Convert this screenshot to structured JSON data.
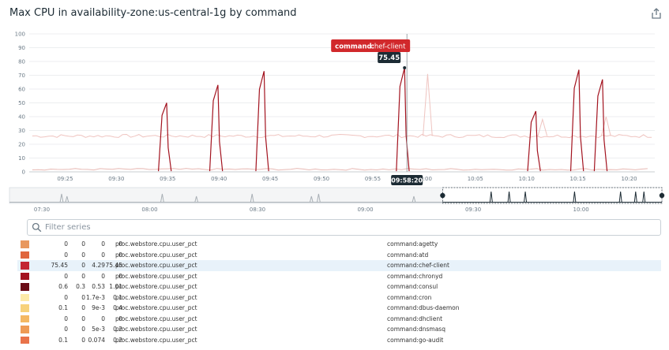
{
  "title": "Max CPU in availability-zone:us-central-1g by command",
  "icons": {
    "share": "share-export-icon",
    "search": "search-icon"
  },
  "filter": {
    "placeholder": "Filter series"
  },
  "tooltip": {
    "key": "command:",
    "value": " chef-client",
    "number": "75.45",
    "time": "09:58:20"
  },
  "chart_data": {
    "type": "line",
    "ylim": [
      0,
      100
    ],
    "yticks": [
      "0",
      "10",
      "20",
      "30",
      "40",
      "50",
      "60",
      "70",
      "80",
      "90",
      "100"
    ],
    "xlim_minutes": [
      561.5,
      622.5
    ],
    "xticks": [
      {
        "label": "09:25",
        "m": 565
      },
      {
        "label": "09:30",
        "m": 570
      },
      {
        "label": "09:35",
        "m": 575
      },
      {
        "label": "09:40",
        "m": 580
      },
      {
        "label": "09:45",
        "m": 585
      },
      {
        "label": "09:50",
        "m": 590
      },
      {
        "label": "09:55",
        "m": 595
      },
      {
        "label": "10:00",
        "m": 600
      },
      {
        "label": "10:05",
        "m": 605
      },
      {
        "label": "10:10",
        "m": 610
      },
      {
        "label": "10:15",
        "m": 615
      },
      {
        "label": "10:20",
        "m": 620
      }
    ],
    "background_level": 26,
    "spikes": [
      {
        "m": 575.0,
        "v": 50
      },
      {
        "m": 580.0,
        "v": 63
      },
      {
        "m": 584.5,
        "v": 73
      },
      {
        "m": 598.2,
        "v": 75.45
      },
      {
        "m": 611.0,
        "v": 44
      },
      {
        "m": 615.2,
        "v": 74
      },
      {
        "m": 617.5,
        "v": 67
      }
    ],
    "ghost_spikes": [
      {
        "m": 600.5,
        "v": 71
      },
      {
        "m": 611.7,
        "v": 38
      },
      {
        "m": 617.9,
        "v": 40
      }
    ],
    "cursor_m": 598.33,
    "overview": {
      "xlim_minutes": [
        441,
        622.5
      ],
      "xticks": [
        {
          "label": "07:30",
          "m": 450
        },
        {
          "label": "08:00",
          "m": 480
        },
        {
          "label": "08:30",
          "m": 510
        },
        {
          "label": "09:00",
          "m": 540
        },
        {
          "label": "09:30",
          "m": 570
        },
        {
          "label": "10:00",
          "m": 600
        }
      ],
      "window": [
        561.5,
        622.5
      ]
    }
  },
  "legend": [
    {
      "color": "#e8985e",
      "v": [
        "0",
        "0",
        "0",
        "0"
      ],
      "metric": "proc.webstore.cpu.user_pct",
      "tag": "command:agetty"
    },
    {
      "color": "#e0663e",
      "v": [
        "0",
        "0",
        "0",
        "0"
      ],
      "metric": "proc.webstore.cpu.user_pct",
      "tag": "command:atd"
    },
    {
      "color": "#c32532",
      "v": [
        "75.45",
        "0",
        "4.29",
        "75.45"
      ],
      "metric": "proc.webstore.cpu.user_pct",
      "tag": "command:chef-client",
      "highlight": true
    },
    {
      "color": "#a3131f",
      "v": [
        "0",
        "0",
        "0",
        "0"
      ],
      "metric": "proc.webstore.cpu.user_pct",
      "tag": "command:chronyd"
    },
    {
      "color": "#6b0c16",
      "v": [
        "0.6",
        "0.3",
        "0.53",
        "1.01"
      ],
      "metric": "proc.webstore.cpu.user_pct",
      "tag": "command:consul"
    },
    {
      "color": "#fdeaa8",
      "v": [
        "0",
        "0",
        "1.7e-3",
        "0.1"
      ],
      "metric": "proc.webstore.cpu.user_pct",
      "tag": "command:cron"
    },
    {
      "color": "#f7d27b",
      "v": [
        "0.1",
        "0",
        "9e-3",
        "0.4"
      ],
      "metric": "proc.webstore.cpu.user_pct",
      "tag": "command:dbus-daemon"
    },
    {
      "color": "#f4b862",
      "v": [
        "0",
        "0",
        "0",
        "0"
      ],
      "metric": "proc.webstore.cpu.user_pct",
      "tag": "command:dhclient"
    },
    {
      "color": "#ee9b55",
      "v": [
        "0",
        "0",
        "5e-3",
        "0.2"
      ],
      "metric": "proc.webstore.cpu.user_pct",
      "tag": "command:dnsmasq"
    },
    {
      "color": "#e9734a",
      "v": [
        "0.1",
        "0",
        "0.074",
        "0.2"
      ],
      "metric": "proc.webstore.cpu.user_pct",
      "tag": "command:go-audit"
    }
  ]
}
